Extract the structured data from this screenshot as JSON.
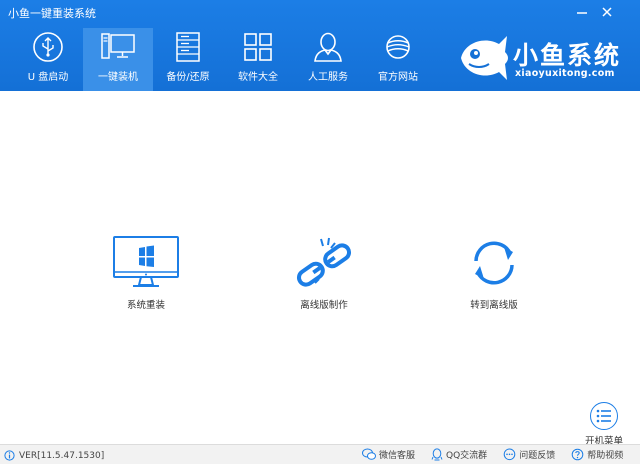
{
  "window": {
    "title": "小鱼一键重装系统"
  },
  "nav": [
    {
      "label": "U 盘启动",
      "icon": "usb-icon"
    },
    {
      "label": "一键装机",
      "icon": "monitor-icon",
      "active": true
    },
    {
      "label": "备份/还原",
      "icon": "server-icon"
    },
    {
      "label": "软件大全",
      "icon": "grid-icon"
    },
    {
      "label": "人工服务",
      "icon": "user-icon"
    },
    {
      "label": "官方网站",
      "icon": "planet-icon"
    }
  ],
  "brand": {
    "name": "小鱼系统",
    "sub": "xiaoyuxitong.com"
  },
  "features": [
    {
      "label": "系统重装",
      "icon": "windows-monitor-icon"
    },
    {
      "label": "离线版制作",
      "icon": "broken-link-icon"
    },
    {
      "label": "转到离线版",
      "icon": "sync-icon"
    }
  ],
  "boot_menu": {
    "label": "开机菜单"
  },
  "status": {
    "version": "VER[11.5.47.1530]",
    "links": [
      {
        "label": "微信客服",
        "icon": "wechat-icon"
      },
      {
        "label": "QQ交流群",
        "icon": "qq-icon"
      },
      {
        "label": "问题反馈",
        "icon": "chat-icon"
      },
      {
        "label": "帮助视频",
        "icon": "help-icon"
      }
    ]
  },
  "colors": {
    "accent": "#1c7ee6",
    "header": "#1470d6",
    "active_tab": "#3a90e8"
  }
}
